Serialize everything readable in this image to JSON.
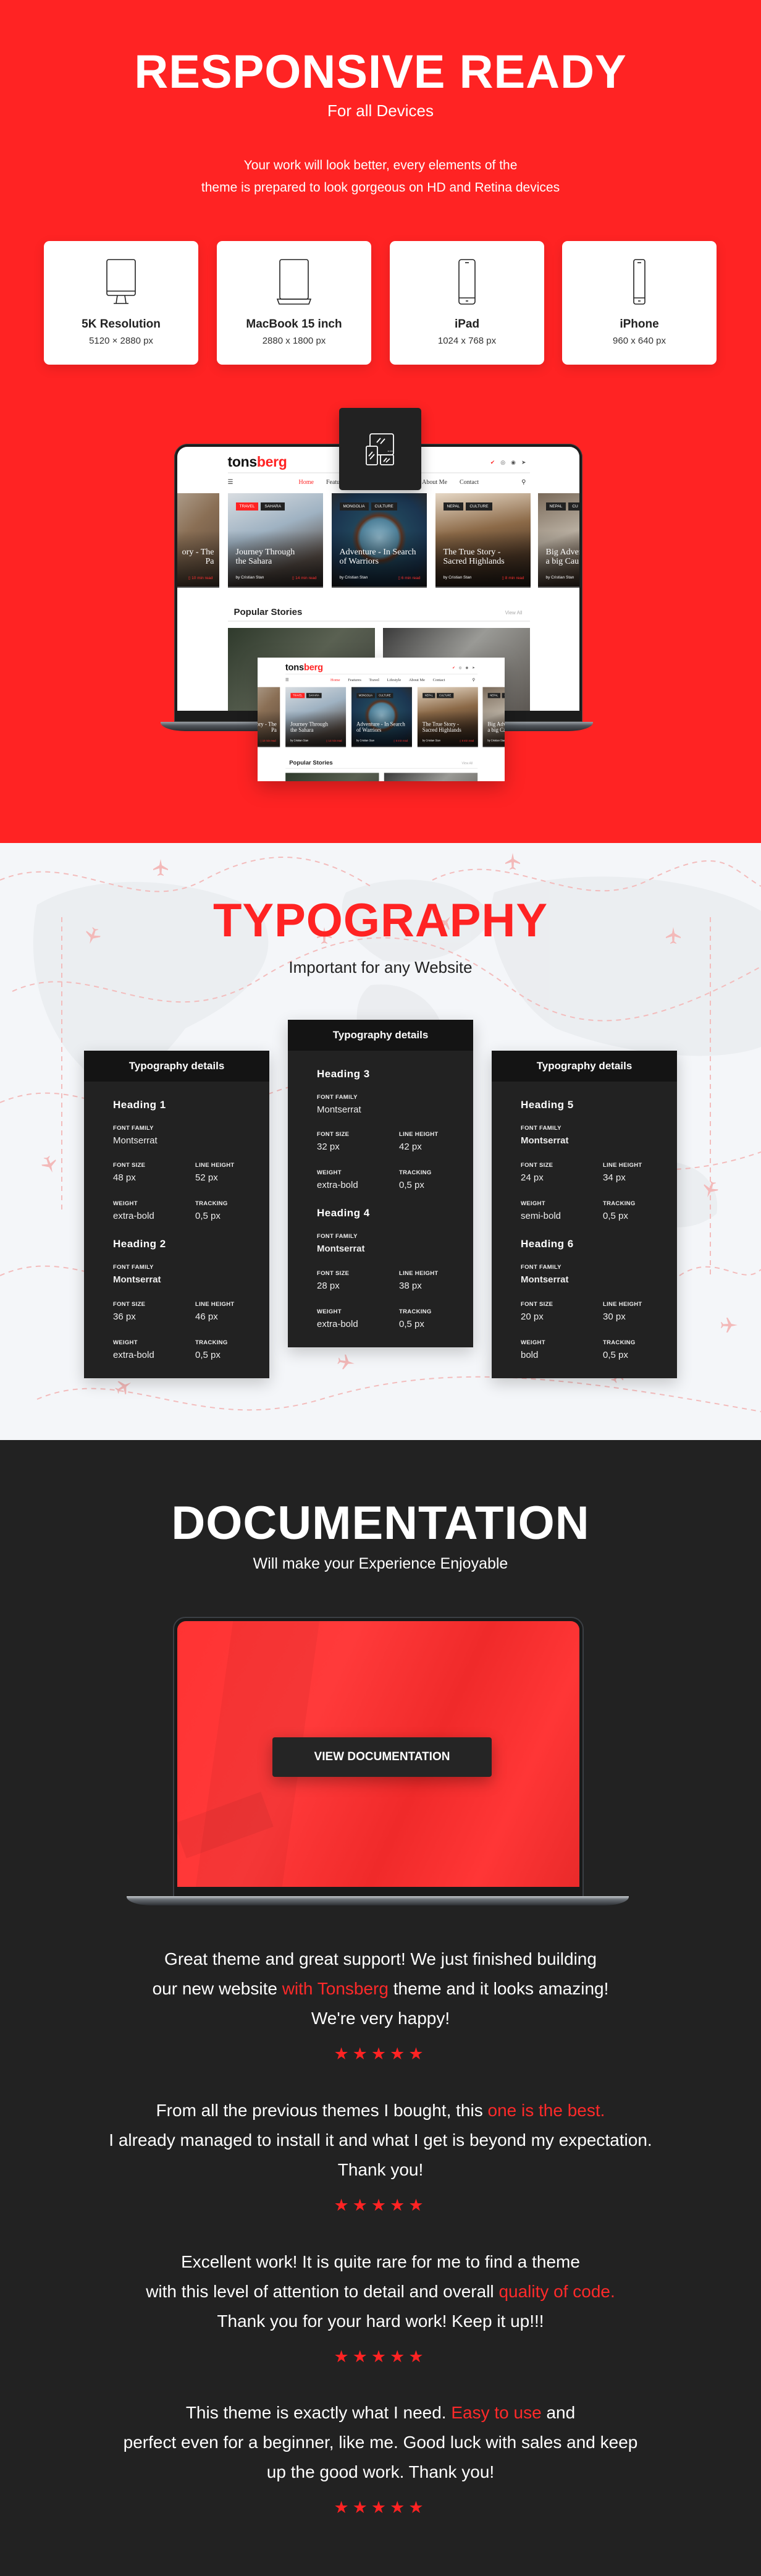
{
  "colors": {
    "accent": "#ff2323",
    "dark": "#222222",
    "card_header": "#141414"
  },
  "responsive": {
    "title": "RESPONSIVE READY",
    "subtitle": "For all Devices",
    "description_lines": [
      "Your work will look better, every elements of the",
      "theme is prepared to look gorgeous on HD and Retina devices"
    ],
    "devices": [
      {
        "icon": "monitor-icon",
        "name": "5K Resolution",
        "resolution": "5120 × 2880 px"
      },
      {
        "icon": "laptop-icon",
        "name": "MacBook 15 inch",
        "resolution": "2880 x 1800 px"
      },
      {
        "icon": "tablet-icon",
        "name": "iPad",
        "resolution": "1024 x 768 px"
      },
      {
        "icon": "phone-icon",
        "name": "iPhone",
        "resolution": "960 x 640 px"
      }
    ],
    "badge_icon": "responsive-devices-icon"
  },
  "mockup": {
    "logo_a": "tons",
    "logo_b": "berg",
    "social_icons": [
      "twitter-icon",
      "instagram-icon",
      "dribbble-icon",
      "telegram-icon"
    ],
    "nav": [
      "Home",
      "Features",
      "Travel",
      "Lifestyle",
      "About Me",
      "Contact"
    ],
    "cards": [
      {
        "tags": [
          {
            "t": "",
            "red": false
          }
        ],
        "title": "ory - The\nPa",
        "author": "",
        "read": "10 min read",
        "bg": "linear-gradient(135deg,#cfc8bd,#8a6f55 55%,#5e4a3a)"
      },
      {
        "tags": [
          {
            "t": "TRAVEL",
            "red": true
          },
          {
            "t": "SAHARA",
            "red": false
          }
        ],
        "title": "Journey  Through\nthe Sahara",
        "author": "by Cristian Stan",
        "read": "14 min read",
        "bg": "linear-gradient(160deg,#d9dde1,#9fb2c2 40%,#5b5049 75%,#3a3330)"
      },
      {
        "tags": [
          {
            "t": "MONGOLIA",
            "red": false
          },
          {
            "t": "CULTURE",
            "red": false
          }
        ],
        "title": "Adventure - In Search\nof  Warriors",
        "author": "by Cristian Stan",
        "read": "6 min read",
        "bg": "radial-gradient(circle at 50% 48%,#8fb6c8 0,#4d7f98 28%,#5a3320 33%,#20445a 40%,#1b3550 70%,#2a2a2a)"
      },
      {
        "tags": [
          {
            "t": "NEPAL",
            "red": false
          },
          {
            "t": "CULTURE",
            "red": false
          }
        ],
        "title": "The True Story -\nSacred Highlands",
        "author": "by Cristian Stan",
        "read": "8 min read",
        "bg": "linear-gradient(170deg,#e6d8c6,#8c6a48 40%,#4e3826 70%,#2d241d)"
      },
      {
        "tags": [
          {
            "t": "NEPAL",
            "red": false
          },
          {
            "t": "CU",
            "red": false
          }
        ],
        "title": "Big Adver\na big Cau",
        "author": "by Cristian Stan",
        "read": "",
        "bg": "linear-gradient(160deg,#7a6a5a,#b8aea0 40%,#5c4a3c 75%,#2f2824)"
      }
    ],
    "popular_title": "Popular Stories",
    "view_all": "View All"
  },
  "typography": {
    "title": "TYPOGRAPHY",
    "subtitle": "Important for any Website",
    "labels": {
      "font_family": "FONT FAMILY",
      "font_size": "FONT SIZE",
      "line_height": "LINE HEIGHT",
      "weight": "WEIGHT",
      "tracking": "TRACKING"
    },
    "cards": [
      {
        "header": "Typography details",
        "headings": [
          {
            "title": "Heading 1",
            "family": "Montserrat",
            "family_bold": false,
            "size": "48 px",
            "line_height": "52 px",
            "weight": "extra-bold",
            "tracking": "0,5 px"
          },
          {
            "title": "Heading 2",
            "family": "Montserrat",
            "family_bold": true,
            "size": "36 px",
            "line_height": "46 px",
            "weight": "extra-bold",
            "tracking": "0,5 px"
          }
        ]
      },
      {
        "header": "Typography details",
        "headings": [
          {
            "title": "Heading 3",
            "family": "Montserrat",
            "family_bold": false,
            "size": "32 px",
            "line_height": "42 px",
            "weight": "extra-bold",
            "tracking": "0,5 px"
          },
          {
            "title": "Heading 4",
            "family": "Montserrat",
            "family_bold": true,
            "size": "28 px",
            "line_height": "38 px",
            "weight": "extra-bold",
            "tracking": "0,5 px"
          }
        ]
      },
      {
        "header": "Typography details",
        "headings": [
          {
            "title": "Heading 5",
            "family": "Montserrat",
            "family_bold": true,
            "size": "24 px",
            "line_height": "34 px",
            "weight": "semi-bold",
            "tracking": "0,5 px"
          },
          {
            "title": "Heading 6",
            "family": "Montserrat",
            "family_bold": true,
            "size": "20 px",
            "line_height": "30 px",
            "weight": "bold",
            "tracking": "0,5 px"
          }
        ]
      }
    ]
  },
  "documentation": {
    "title": "DOCUMENTATION",
    "subtitle": "Will make your Experience Enjoyable",
    "button": "VIEW DOCUMENTATION"
  },
  "testimonials": [
    {
      "rating": 5,
      "lines": [
        [
          {
            "t": "Great theme and great support! We just finished building"
          }
        ],
        [
          {
            "t": "our new website "
          },
          {
            "t": "with Tonsberg",
            "hl": true
          },
          {
            "t": " theme and it looks amazing!"
          }
        ],
        [
          {
            "t": "We're very happy!"
          }
        ]
      ]
    },
    {
      "rating": 5,
      "lines": [
        [
          {
            "t": "From all the previous themes I bought, this "
          },
          {
            "t": "one is the best.",
            "hl": true
          }
        ],
        [
          {
            "t": "I already managed to install it and what I get is beyond my expectation."
          }
        ],
        [
          {
            "t": "Thank you!"
          }
        ]
      ]
    },
    {
      "rating": 5,
      "lines": [
        [
          {
            "t": "Excellent work! It is quite rare for me to find a theme"
          }
        ],
        [
          {
            "t": "with this level of attention to detail and overall "
          },
          {
            "t": "quality of code.",
            "hl": true
          }
        ],
        [
          {
            "t": "Thank you for your hard work! Keep it up!!!"
          }
        ]
      ]
    },
    {
      "rating": 5,
      "lines": [
        [
          {
            "t": "This theme is exactly what I need. "
          },
          {
            "t": "Easy to use",
            "hl": true
          },
          {
            "t": " and"
          }
        ],
        [
          {
            "t": "perfect even for a beginner, like me. Good luck with sales and keep"
          }
        ],
        [
          {
            "t": "up the good work. Thank you!"
          }
        ]
      ]
    }
  ]
}
